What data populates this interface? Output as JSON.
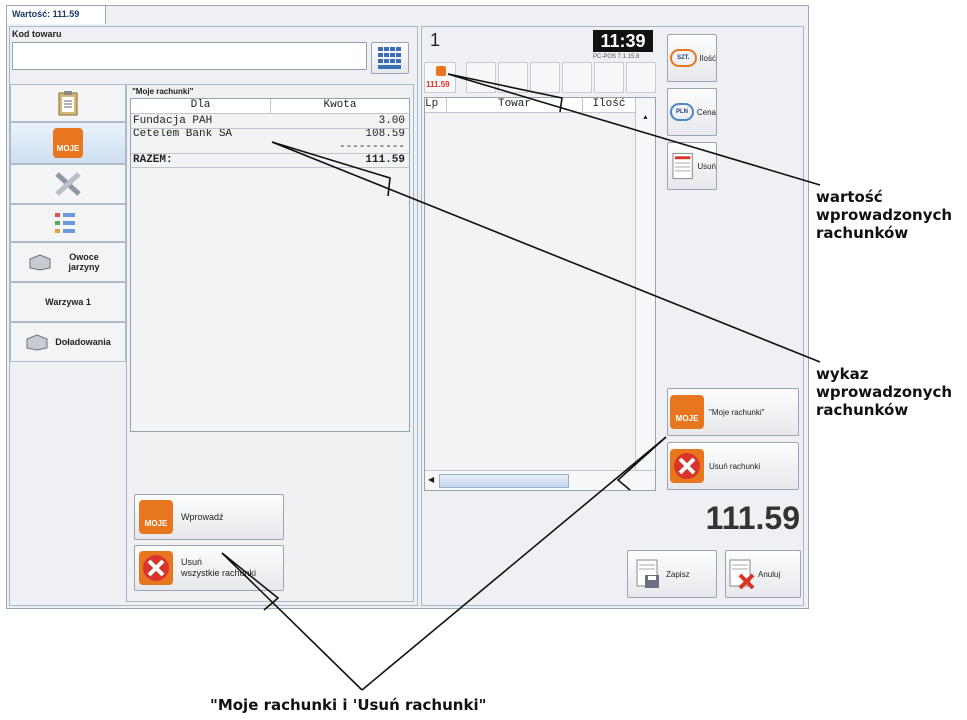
{
  "window": {
    "tab_title": "Wartość: 111.59"
  },
  "product_code": {
    "label": "Kod towaru",
    "value": ""
  },
  "left_tabs": [
    {
      "name": "clipboard"
    },
    {
      "name": "moje-rachunki",
      "icon_text": "MOJE"
    },
    {
      "name": "tools"
    },
    {
      "name": "settings-list"
    },
    {
      "label": "Owoce jarzyny"
    },
    {
      "label": "Warzywa 1"
    },
    {
      "label": "Doładowania"
    }
  ],
  "bills_panel": {
    "title": "\"Moje rachunki\"",
    "columns": [
      "Dla",
      "Kwota"
    ],
    "rows": [
      {
        "dla": "Fundacja PAH",
        "kwota": "3.00"
      },
      {
        "dla": "Cetelem Bank SA",
        "kwota": "108.59"
      }
    ],
    "separator": "----------",
    "total_label": "RAZEM:",
    "total_value": "111.59",
    "enter_button": "Wprowadź",
    "delete_all_button_line1": "Usuń",
    "delete_all_button_line2": "wszystkie rachunki"
  },
  "receipt": {
    "number": "1",
    "clock": "11:39",
    "version": "PC-POS 7.1.15.8",
    "bill_value": "111.59",
    "columns": [
      "Lp",
      "Towar",
      "Ilość"
    ],
    "total": "111.59"
  },
  "side_buttons": {
    "qty_icon": "SZT.",
    "qty": "Ilość",
    "price_icon": "PLN",
    "price": "Cena",
    "remove": "Usuń",
    "my_bills": "\"Moje rachunki\"",
    "remove_bills": "Usuń rachunki",
    "save": "Zapisz",
    "cancel": "Anuluj"
  },
  "annotations": {
    "value_line1": "wartość",
    "value_line2": "wprowadzonych",
    "value_line3": "rachunków",
    "list_line1": "wykaz",
    "list_line2": "wprowadzonych",
    "list_line3": "rachunków",
    "bottom": "\"Moje rachunki i 'Usuń rachunki\""
  },
  "colors": {
    "accent_orange": "#e8761e",
    "red_x": "#d9342b",
    "clock_bg": "#111111"
  }
}
